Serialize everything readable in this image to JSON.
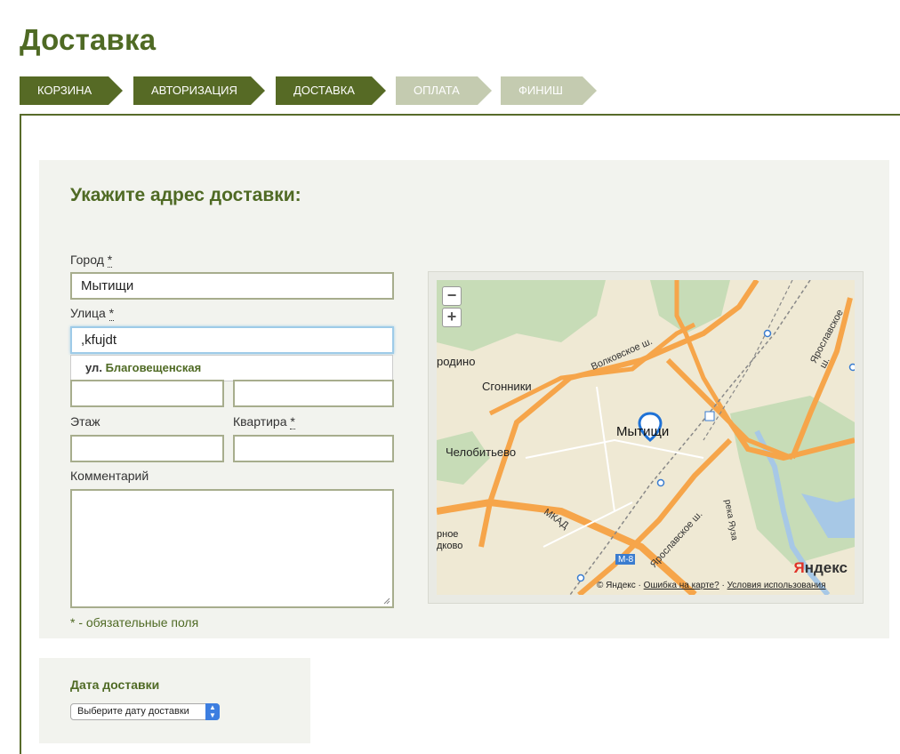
{
  "page": {
    "title": "Доставка"
  },
  "steps": [
    {
      "label": "КОРЗИНА",
      "state": "done"
    },
    {
      "label": "АВТОРИЗАЦИЯ",
      "state": "done"
    },
    {
      "label": "ДОСТАВКА",
      "state": "current"
    },
    {
      "label": "ОПЛАТА",
      "state": "upcoming"
    },
    {
      "label": "ФИНИШ",
      "state": "upcoming"
    }
  ],
  "address": {
    "title": "Укажите адрес доставки:",
    "city_label": "Город",
    "street_label": "Улица",
    "floor_label": "Этаж",
    "apartment_label": "Квартира",
    "comment_label": "Комментарий",
    "required_mark": "*",
    "city_value": "Мытищи",
    "street_value": ",kfujdt",
    "house_value": "",
    "building_value": "",
    "floor_value": "",
    "apartment_value": "",
    "suggestion_prefix": "ул.",
    "suggestion_name": "Благовещенская",
    "required_note": "* - обязательные поля"
  },
  "map": {
    "zoom_out": "−",
    "zoom_in": "+",
    "city": "Мытищи",
    "places": [
      "Сгонники",
      "Челобитьево",
      "родино",
      "рное",
      "дково"
    ],
    "roads": [
      "Волковское ш.",
      "Ярославское ш.",
      "Ярославское ш.",
      "МКАД",
      "река Яуза",
      "М-8"
    ],
    "logo_y": "Я",
    "logo_rest": "ндекс",
    "copyright": "© Яндекс",
    "error_link": "Ошибка на карте?",
    "terms_link": "Условия использования",
    "colors": {
      "road_major": "#f6a54a",
      "road_minor": "#ffffff",
      "water": "#a7c8e6",
      "forest": "#c7dcb7"
    }
  },
  "delivery_date": {
    "title": "Дата доставки",
    "select_value": "Выберите дату доставки"
  },
  "colors": {
    "brand_green": "#4f6a24",
    "step_active": "#566a25",
    "step_inactive": "#c4cbb0",
    "panel_bg": "#f2f3ee"
  }
}
